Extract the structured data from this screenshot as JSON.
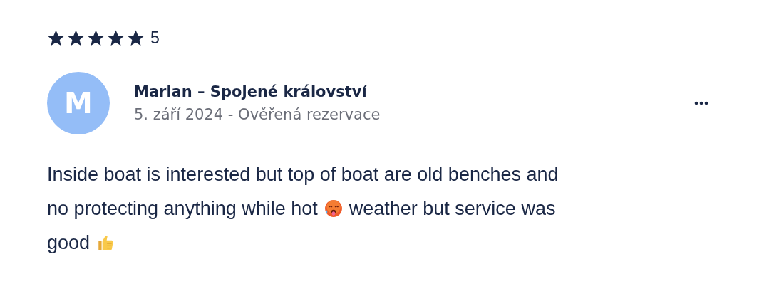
{
  "rating": {
    "stars": 5,
    "value": "5"
  },
  "review": {
    "avatar_letter": "M",
    "author": "Marian – Spojené království",
    "meta": "5. září 2024 - Ověřená rezervace",
    "body_lines": [
      [
        {
          "kind": "text",
          "text": "Inside boat is interested but top of boat are old benches and"
        }
      ],
      [
        {
          "kind": "text",
          "text": "no protecting anything while hot"
        },
        {
          "kind": "hot-face"
        },
        {
          "kind": "text",
          "text": "weather but service was"
        }
      ],
      [
        {
          "kind": "text",
          "text": "good"
        },
        {
          "kind": "thumbs-up"
        }
      ]
    ]
  }
}
